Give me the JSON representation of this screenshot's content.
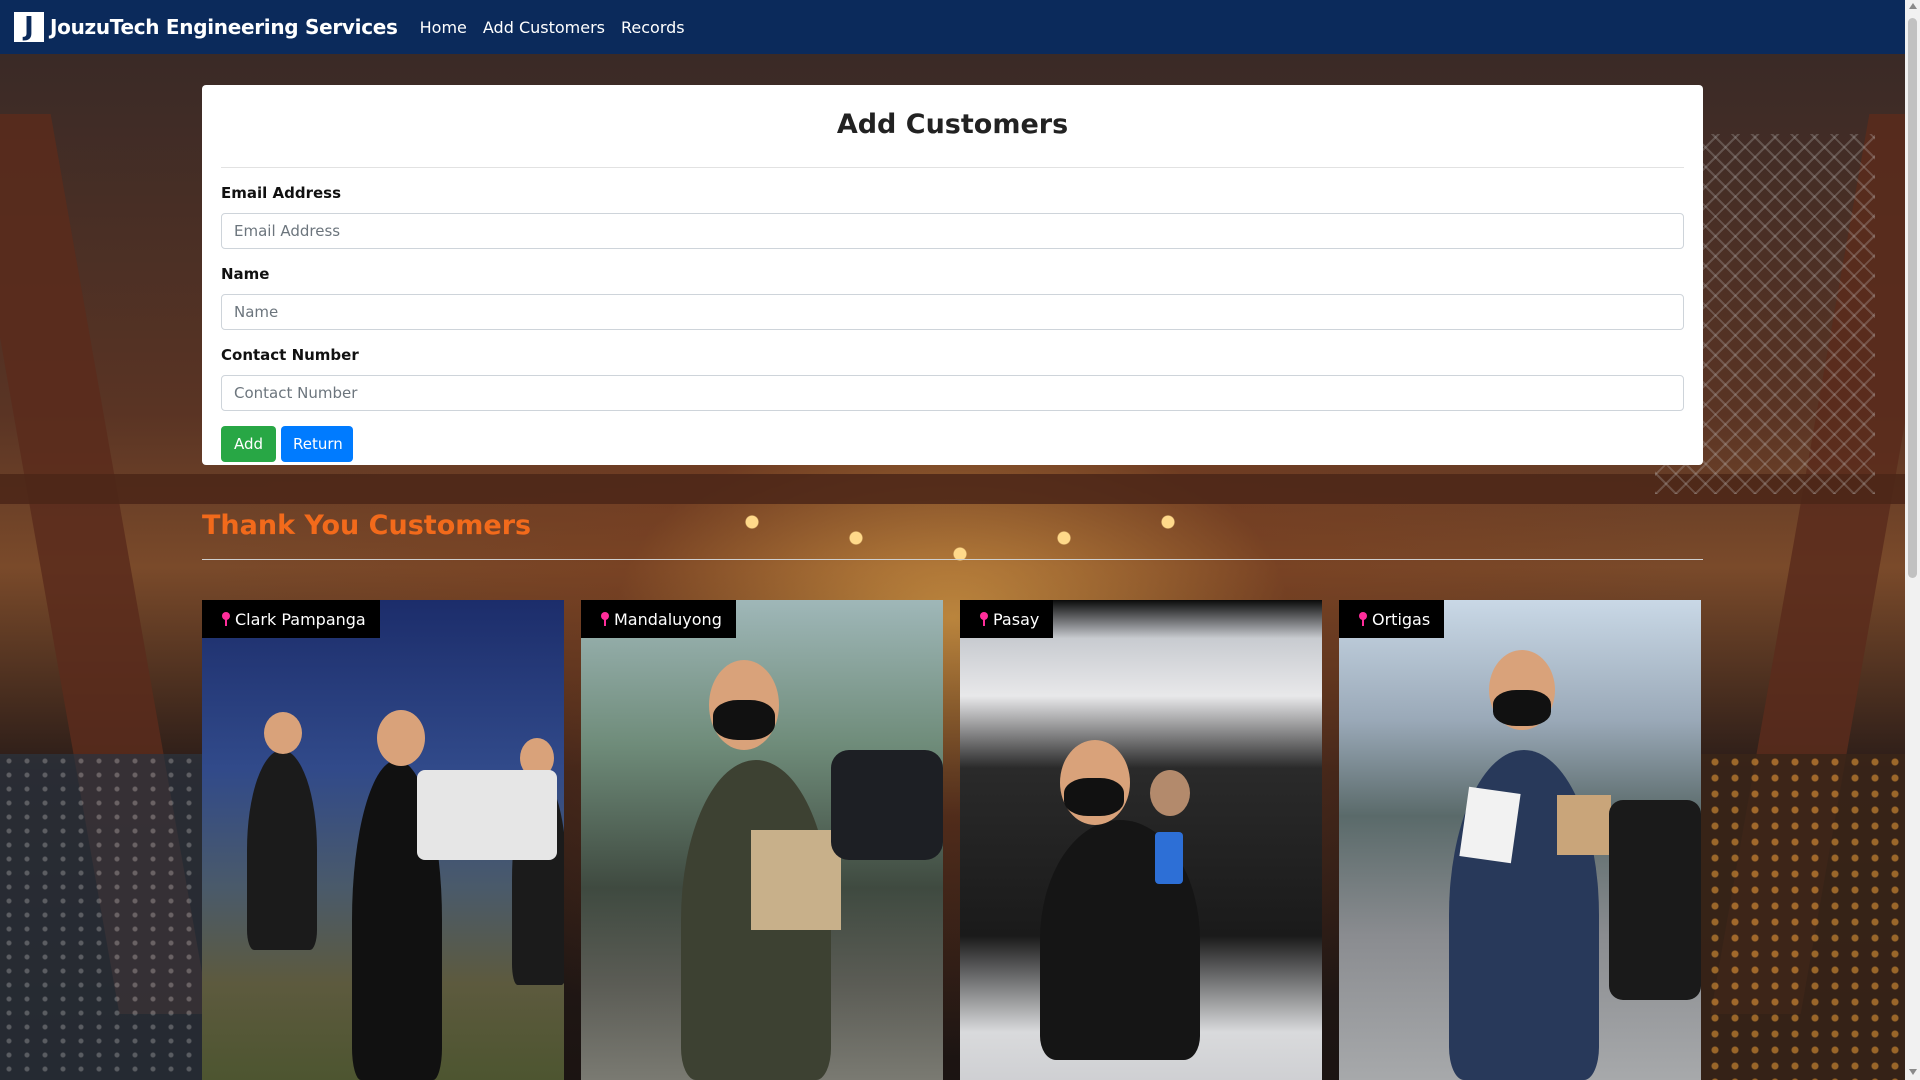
{
  "navbar": {
    "logo_letter": "J",
    "brand": "JouzuTech Engineering Services",
    "links": [
      {
        "label": "Home"
      },
      {
        "label": "Add Customers"
      },
      {
        "label": "Records"
      }
    ]
  },
  "form": {
    "title": "Add Customers",
    "fields": [
      {
        "label": "Email Address",
        "placeholder": "Email Address",
        "value": ""
      },
      {
        "label": "Name",
        "placeholder": "Name",
        "value": ""
      },
      {
        "label": "Contact Number",
        "placeholder": "Contact Number",
        "value": ""
      }
    ],
    "add_label": "Add",
    "return_label": "Return"
  },
  "thanks": {
    "title": "Thank You Customers",
    "photos": [
      {
        "location": "Clark Pampanga"
      },
      {
        "location": "Mandaluyong"
      },
      {
        "location": "Pasay"
      },
      {
        "location": "Ortigas"
      }
    ]
  },
  "colors": {
    "navbar": "#0b2a5b",
    "add_button": "#28a745",
    "return_button": "#007bff",
    "thanks_title": "#f26a1b",
    "pin": "#ff2d9b"
  }
}
